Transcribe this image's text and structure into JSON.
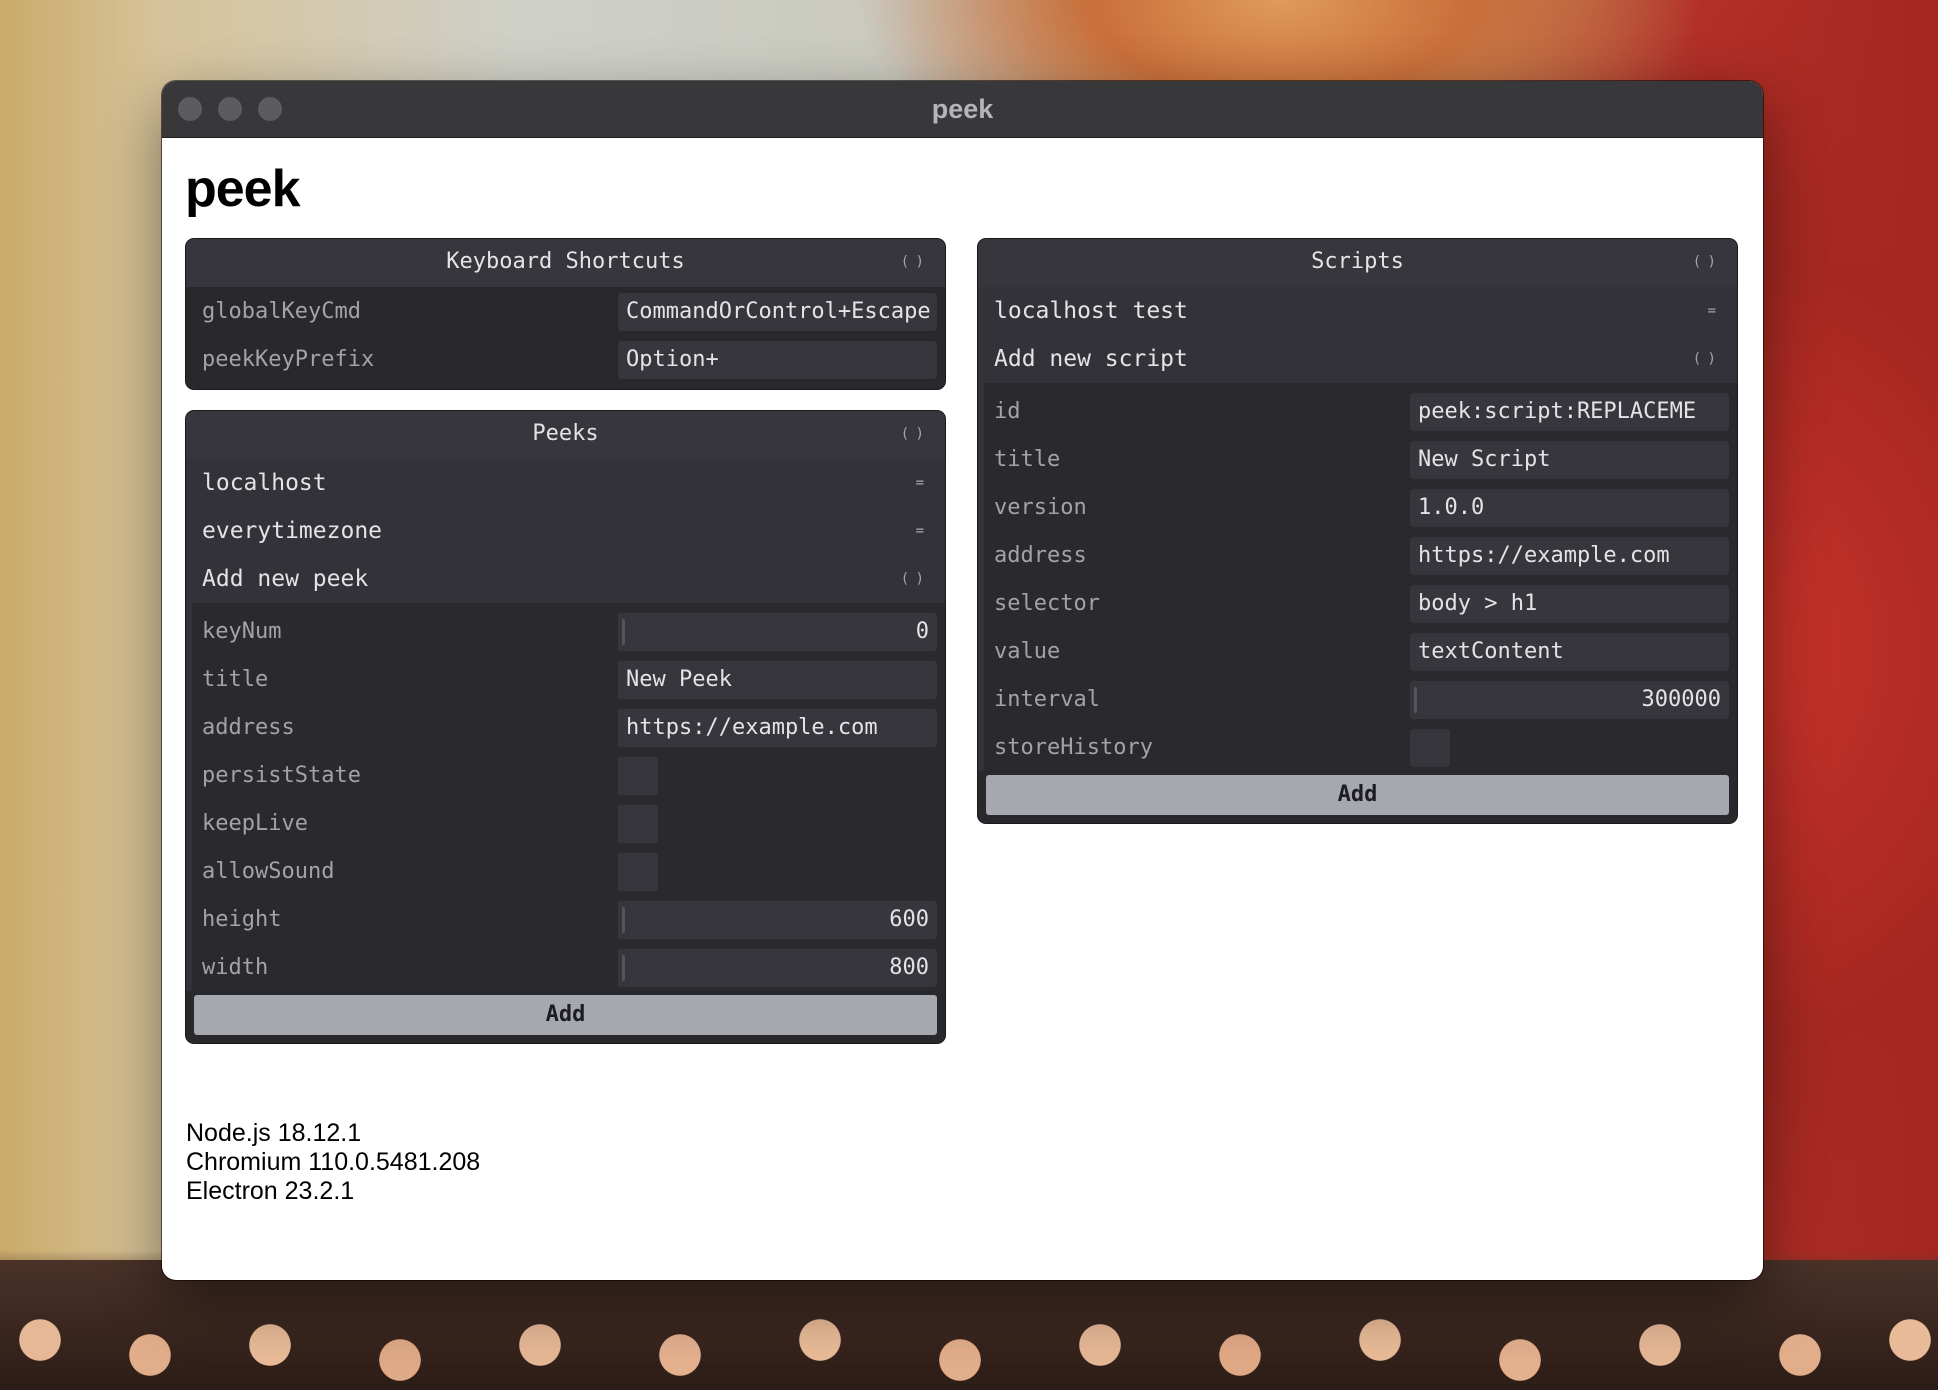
{
  "window": {
    "title": "peek"
  },
  "page": {
    "heading": "peek"
  },
  "keyboard_shortcuts": {
    "title": "Keyboard Shortcuts",
    "rows": [
      {
        "label": "globalKeyCmd",
        "value": "CommandOrControl+Escape"
      },
      {
        "label": "peekKeyPrefix",
        "value": "Option+"
      }
    ]
  },
  "peeks": {
    "title": "Peeks",
    "items": [
      "localhost",
      "everytimezone"
    ],
    "add_folder": "Add new peek",
    "fields": {
      "keyNum": {
        "label": "keyNum",
        "value": "0"
      },
      "title": {
        "label": "title",
        "value": "New Peek"
      },
      "address": {
        "label": "address",
        "value": "https://example.com"
      },
      "persistState": {
        "label": "persistState",
        "checked": false
      },
      "keepLive": {
        "label": "keepLive",
        "checked": false
      },
      "allowSound": {
        "label": "allowSound",
        "checked": false
      },
      "height": {
        "label": "height",
        "value": "600"
      },
      "width": {
        "label": "width",
        "value": "800"
      }
    },
    "add_button": "Add"
  },
  "scripts": {
    "title": "Scripts",
    "items": [
      "localhost test"
    ],
    "add_folder": "Add new script",
    "fields": {
      "id": {
        "label": "id",
        "value": "peek:script:REPLACEME"
      },
      "title": {
        "label": "title",
        "value": "New Script"
      },
      "version": {
        "label": "version",
        "value": "1.0.0"
      },
      "address": {
        "label": "address",
        "value": "https://example.com"
      },
      "selector": {
        "label": "selector",
        "value": "body > h1"
      },
      "value": {
        "label": "value",
        "value": "textContent"
      },
      "interval": {
        "label": "interval",
        "value": "300000"
      },
      "storeHistory": {
        "label": "storeHistory",
        "checked": false
      }
    },
    "add_button": "Add"
  },
  "versions": [
    "Node.js 18.12.1",
    "Chromium 110.0.5481.208",
    "Electron 23.2.1"
  ]
}
